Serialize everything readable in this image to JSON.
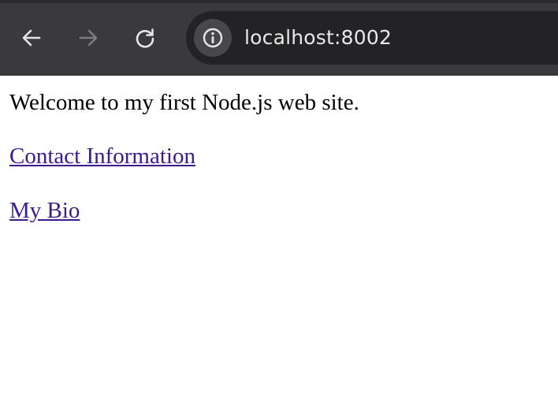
{
  "browser": {
    "url": "localhost:8002",
    "buttons": {
      "back": "back-arrow-icon",
      "forward": "forward-arrow-icon",
      "reload": "reload-icon",
      "site_info": "info-icon"
    },
    "colors": {
      "toolbar": "#3a3a3c",
      "address_bar": "#232325",
      "url_text": "#e8e8e8",
      "forward_disabled": "#7d7d7f"
    }
  },
  "page": {
    "welcome_text": "Welcome to my first Node.js web site.",
    "links": [
      {
        "label": "Contact Information"
      },
      {
        "label": "My Bio"
      }
    ],
    "colors": {
      "visited_link": "#3d1a8a",
      "text": "#000000",
      "background": "#ffffff"
    }
  }
}
